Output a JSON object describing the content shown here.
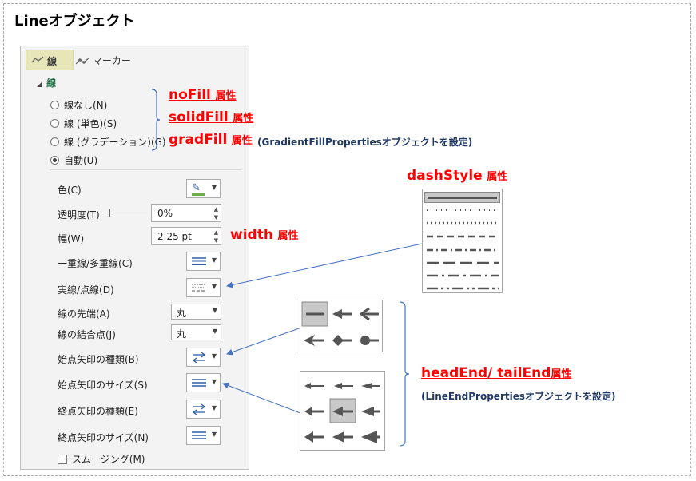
{
  "title": "Lineオブジェクト",
  "panel": {
    "tabs": {
      "line": "線",
      "marker": "マーカー"
    },
    "section": "線",
    "fill_options": [
      "線なし(N)",
      "線 (単色)(S)",
      "線 (グラデーション)(G)",
      "自動(U)"
    ],
    "selected_fill": "自動(U)",
    "color_label": "色(C)",
    "transparency_label": "透明度(T)",
    "transparency_value": "0%",
    "width_label": "幅(W)",
    "width_value": "2.25 pt",
    "compound_label": "一重線/多重線(C)",
    "dash_label": "実線/点線(D)",
    "cap_label": "線の先端(A)",
    "cap_value": "丸",
    "join_label": "線の結合点(J)",
    "join_value": "丸",
    "begin_type_label": "始点矢印の種類(B)",
    "begin_size_label": "始点矢印のサイズ(S)",
    "end_type_label": "終点矢印の種類(E)",
    "end_size_label": "終点矢印のサイズ(N)",
    "smoothing_label": "スムージング(M)"
  },
  "annotations": {
    "nofill": {
      "name": "noFill",
      "suffix": "属性"
    },
    "solidfill": {
      "name": "solidFill",
      "suffix": "属性"
    },
    "gradfill": {
      "name": "gradFill",
      "suffix": "属性",
      "note": "(GradientFillPropertiesオブジェクトを設定)"
    },
    "width": {
      "name": "width",
      "suffix": "属性"
    },
    "dashstyle": {
      "name": "dashStyle",
      "suffix": "属性"
    },
    "headtail": {
      "name": "headEnd/ tailEnd",
      "suffix": "属性",
      "note": "(LineEndPropertiesオブジェクトを設定)"
    }
  },
  "colors": {
    "accent_red": "#ff0000",
    "note_navy": "#1f3864",
    "arrow_blue": "#4472c4",
    "section_green": "#217346"
  }
}
